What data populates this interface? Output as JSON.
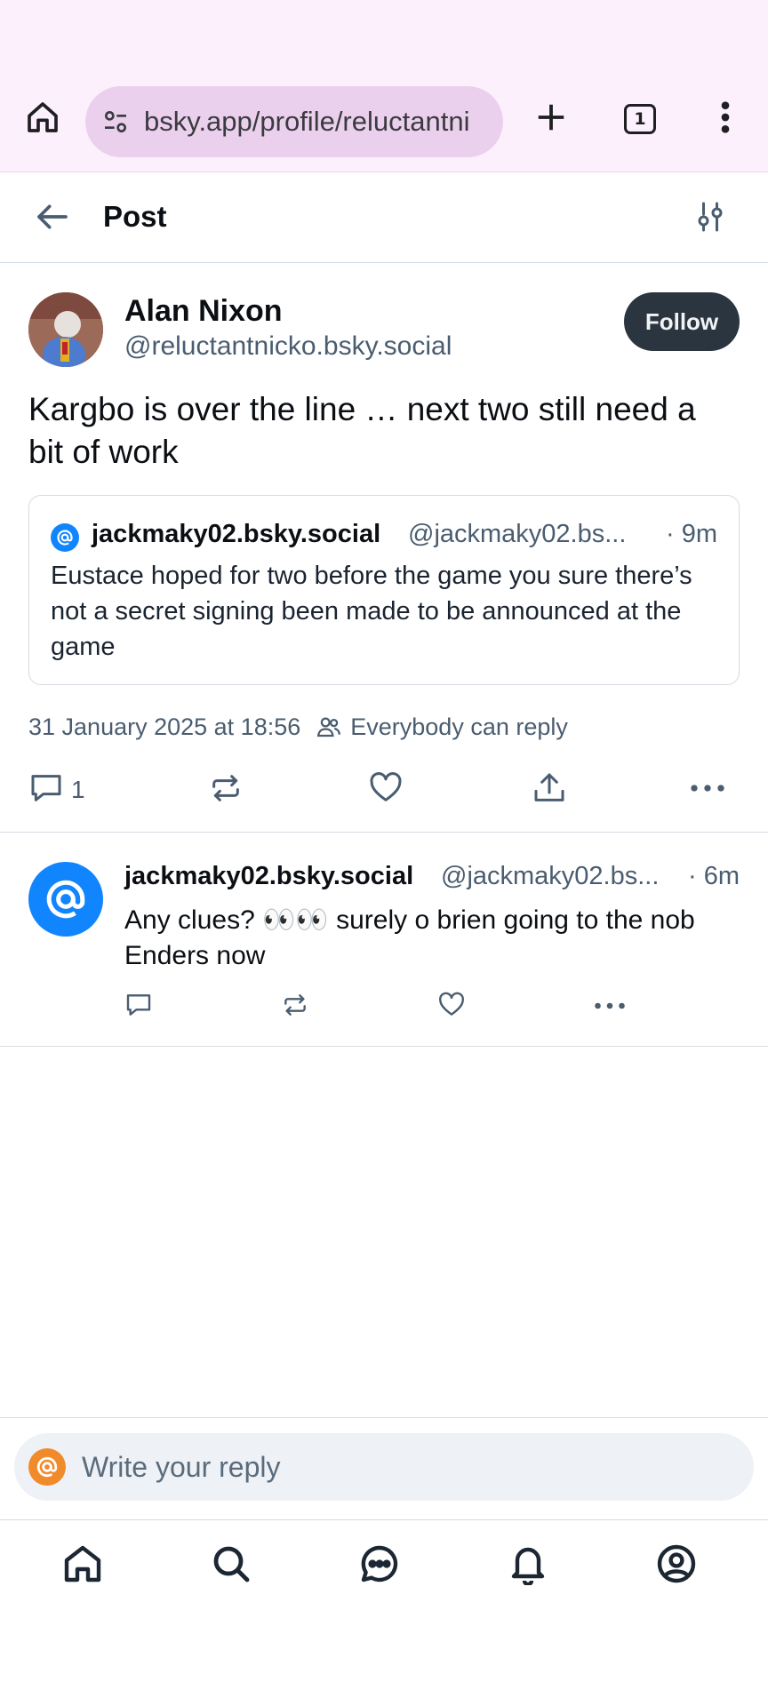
{
  "browser": {
    "url": "bsky.app/profile/reluctantni",
    "tab_count": "1"
  },
  "header": {
    "title": "Post"
  },
  "post": {
    "author_name": "Alan Nixon",
    "author_handle": "@reluctantnicko.bsky.social",
    "follow_label": "Follow",
    "text": "Kargbo is over the line … next two still need a bit of work",
    "quote": {
      "author_name": "jackmaky02.bsky.social",
      "author_handle": "@jackmaky02.bs...",
      "time": "· 9m",
      "text": "Eustace hoped for two before the game you sure there’s not a secret signing been made to be announced at the game"
    },
    "timestamp": "31 January 2025 at 18:56",
    "reply_setting": "Everybody can reply",
    "reply_count": "1"
  },
  "reply": {
    "author_name": "jackmaky02.bsky.social",
    "author_handle": "@jackmaky02.bs...",
    "time": "· 6m",
    "text": "Any clues? 👀👀 surely o brien going to the nob Enders now"
  },
  "composer": {
    "placeholder": "Write your reply"
  },
  "colors": {
    "accent": "#1185fe",
    "follow_bg": "#2b3540",
    "chrome_bg": "#fbf0fb",
    "url_bg": "#ebd0ee",
    "muted_text": "#4a5d70"
  }
}
